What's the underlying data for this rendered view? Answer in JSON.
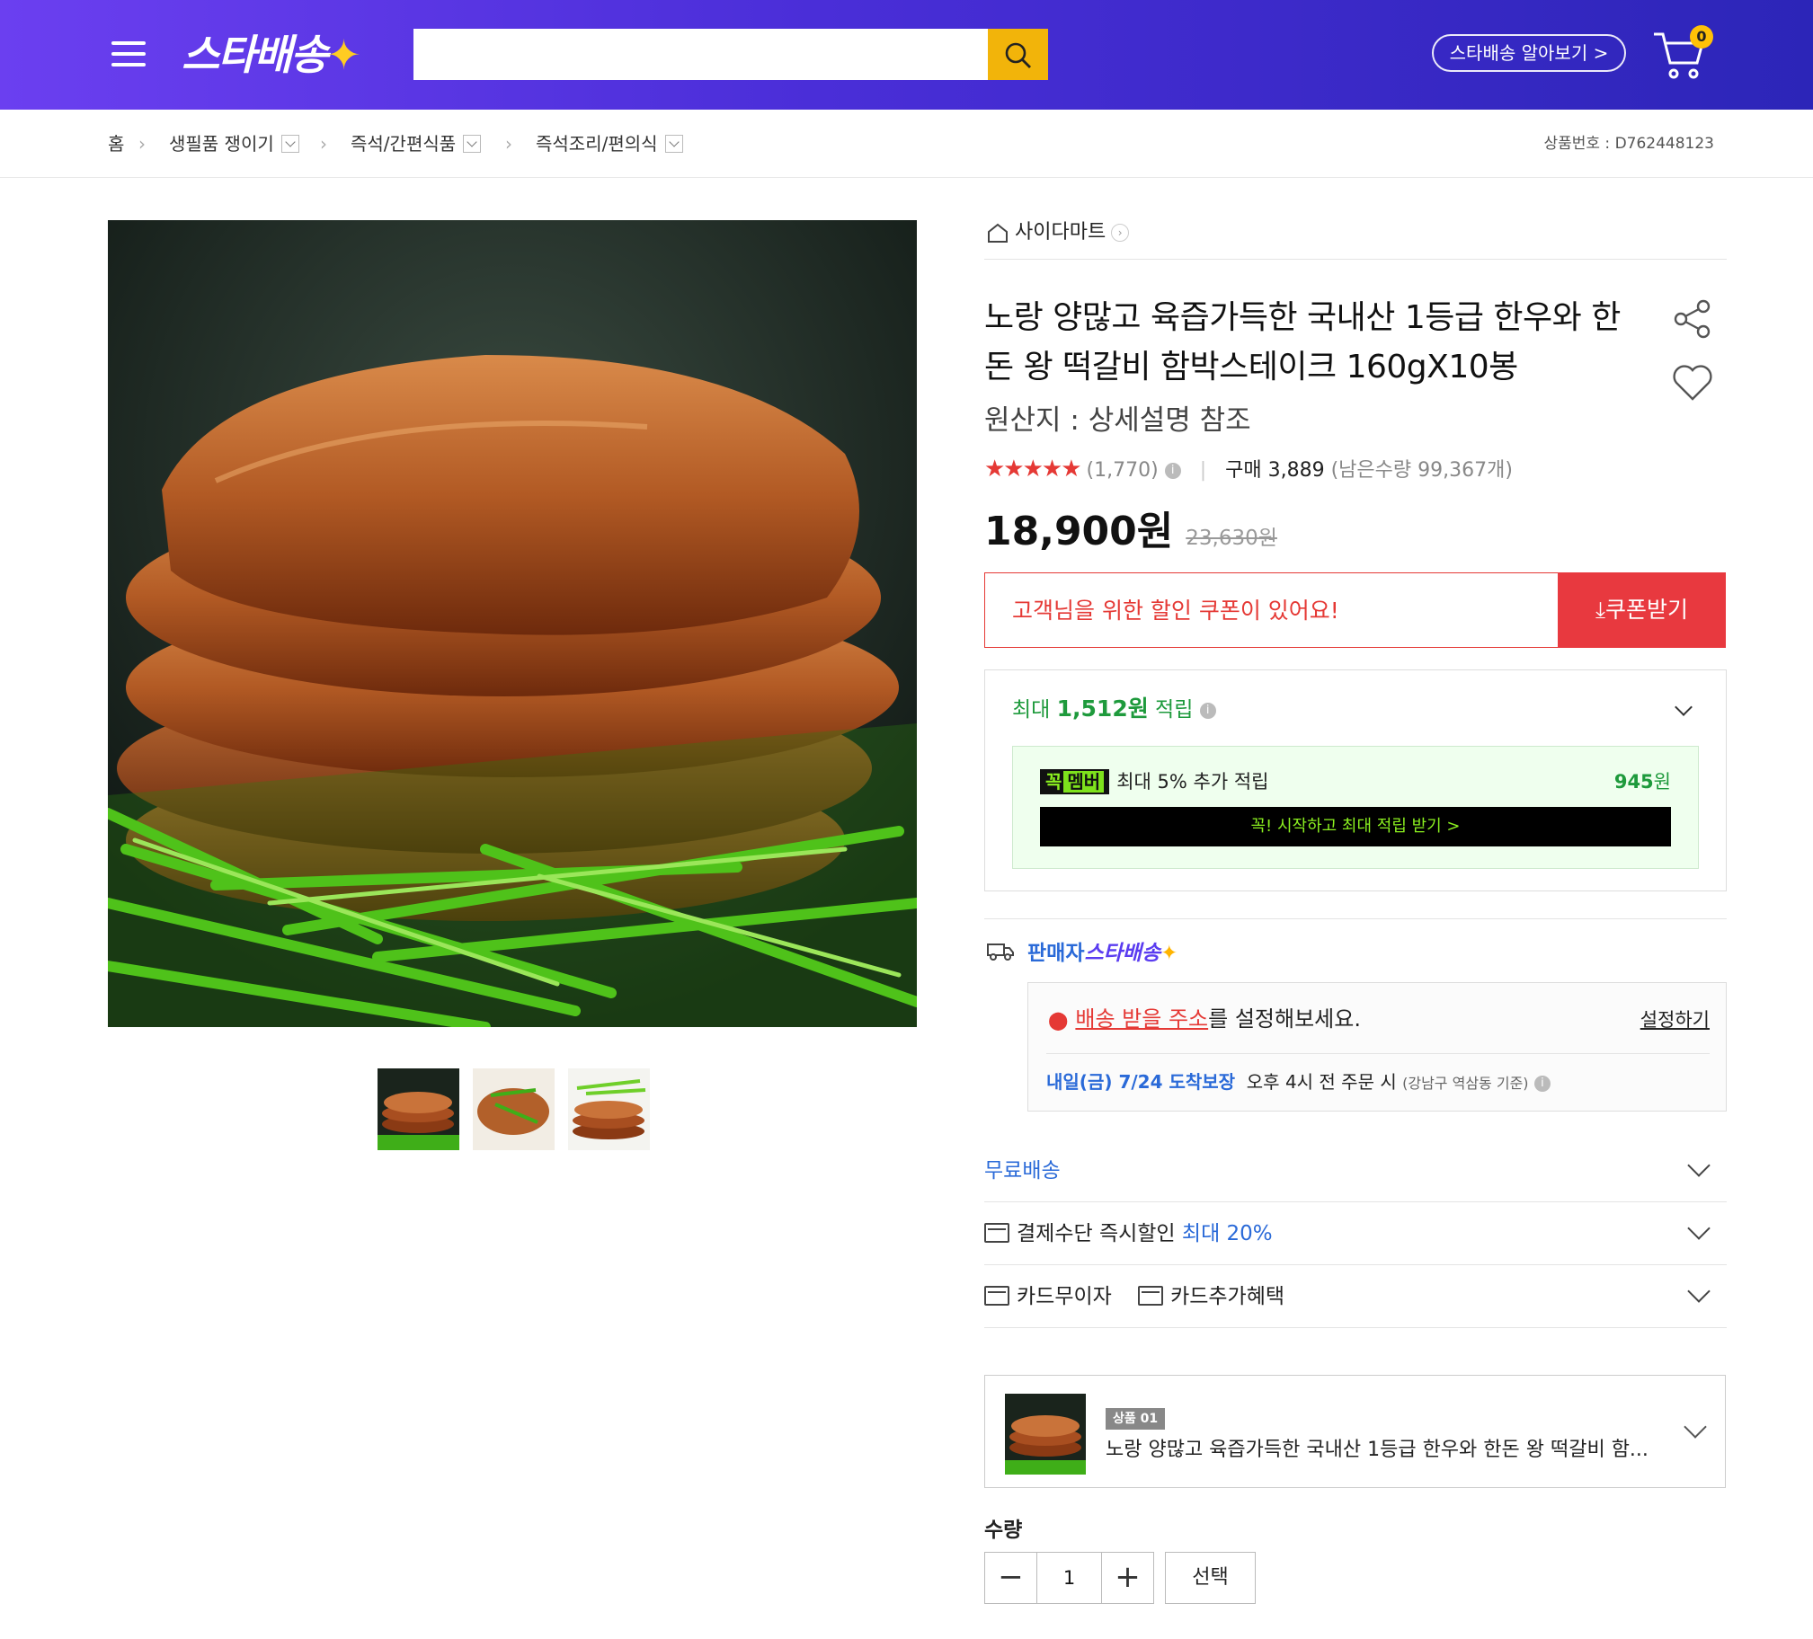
{
  "header": {
    "logo": "스타배송",
    "search_placeholder": "",
    "learn_more": "스타배송 알아보기 >",
    "cart_count": "0"
  },
  "breadcrumb": {
    "items": [
      "홈",
      "생필품 쟁이기",
      "즉석/간편식품",
      "즉석조리/편의식"
    ],
    "product_no": "상품번호 : D762448123"
  },
  "product": {
    "shop": "사이다마트",
    "title": "노랑 양많고 육즙가득한 국내산 1등급 한우와 한돈 왕 떡갈비 함박스테이크 160gX10봉",
    "origin": "원산지 : 상세설명 참조",
    "stars": "★★★★★",
    "rating_count": 4.5,
    "reviews": "(1,770)",
    "purchases": "구매 3,889",
    "stock": "(남은수량 99,367개)",
    "price": "18,900원",
    "original_price": "23,630원"
  },
  "coupon": {
    "text": "고객님을 위한 할인 쿠폰이 있어요!",
    "button": "쿠폰받기"
  },
  "points": {
    "prefix": "최대 ",
    "amount": "1,512원",
    "suffix": " 적립",
    "member_badge": "꼭",
    "member_badge2": "멤버",
    "member_text": "최대 5% 추가 적립",
    "member_amount": "945",
    "member_unit": "원",
    "member_bar": "꼭! 시작하고 최대 적립 받기 >"
  },
  "delivery": {
    "seller_prefix": "판매자",
    "seller_logo": "스타배송",
    "addr_link": "배송 받을 주소",
    "addr_rest": "를 설정해보세요.",
    "set_button": "설정하기",
    "eta": "내일(금) 7/24 도착보장",
    "eta_cond": "오후 4시 전 주문 시",
    "eta_loc": "(강남구 역삼동 기준)"
  },
  "rows": {
    "free_ship": "무료배송",
    "pay_discount": "결제수단 즉시할인",
    "pay_discount_max": "최대 20%",
    "card_free": "카드무이자",
    "card_extra": "카드추가혜택"
  },
  "option": {
    "tag": "상품 01",
    "name": "노랑 양많고 육즙가득한 국내산 1등급 한우와 한돈 왕 떡갈비 함..."
  },
  "quantity": {
    "label": "수량",
    "value": "1",
    "select": "선택"
  },
  "colors": {
    "header_start": "#6b3ff0",
    "header_end": "#2c25b8",
    "accent_red": "#e8393f",
    "green": "#1e9a3c",
    "blue": "#2a6ad8",
    "search_btn": "#f2b40a"
  }
}
